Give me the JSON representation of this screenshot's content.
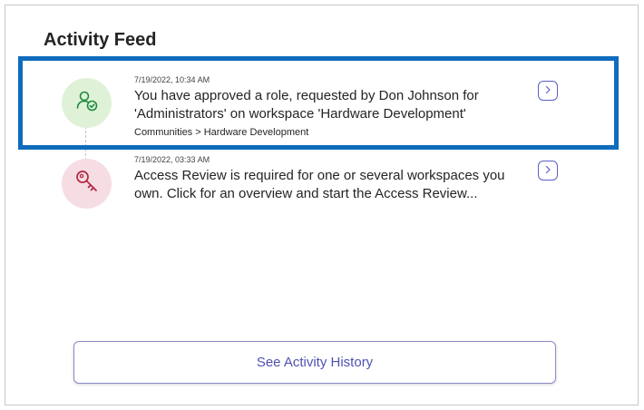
{
  "feed": {
    "title": "Activity Feed",
    "items": [
      {
        "timestamp": "7/19/2022, 10:34 AM",
        "message": "You have approved a role, requested by Don Johnson for 'Administrators' on workspace 'Hardware Development'",
        "breadcrumb": "Communities > Hardware Development",
        "icon": "person-check-icon",
        "icon_bg": "#dff2d8",
        "icon_color": "#1e8a3c",
        "selected": true
      },
      {
        "timestamp": "7/19/2022, 03:33 AM",
        "message": "Access Review is required for one or several workspaces you own. Click for an overview and start the Access Review...",
        "icon": "key-icon",
        "icon_bg": "#f6dde3",
        "icon_color": "#b4263e",
        "selected": false
      }
    ],
    "history_button_label": "See Activity History"
  },
  "colors": {
    "accent": "#5b5fc7",
    "selection": "#0f6cbd"
  }
}
